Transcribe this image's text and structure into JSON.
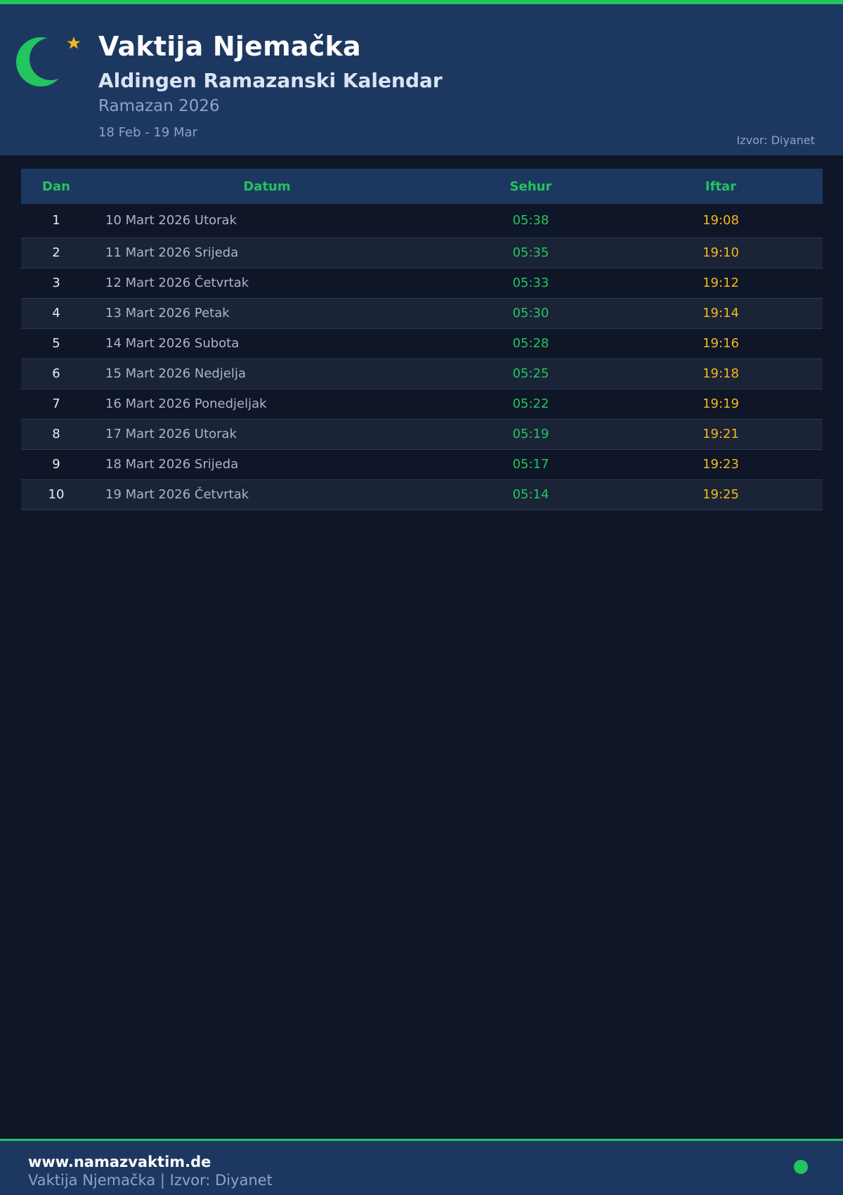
{
  "header": {
    "title": "Vaktija Njemačka",
    "subtitle": "Aldingen Ramazanski Kalendar",
    "period": "Ramazan 2026",
    "date_range": "18 Feb - 19 Mar",
    "source": "Izvor: Diyanet",
    "logo_icon": "crescent-star-icon"
  },
  "table": {
    "columns": [
      "Dan",
      "Datum",
      "Sehur",
      "Iftar"
    ],
    "rows": [
      {
        "dan": "1",
        "datum": "10 Mart 2026 Utorak",
        "sehur": "05:38",
        "iftar": "19:08"
      },
      {
        "dan": "2",
        "datum": "11 Mart 2026 Srijeda",
        "sehur": "05:35",
        "iftar": "19:10"
      },
      {
        "dan": "3",
        "datum": "12 Mart 2026 Četvrtak",
        "sehur": "05:33",
        "iftar": "19:12"
      },
      {
        "dan": "4",
        "datum": "13 Mart 2026 Petak",
        "sehur": "05:30",
        "iftar": "19:14"
      },
      {
        "dan": "5",
        "datum": "14 Mart 2026 Subota",
        "sehur": "05:28",
        "iftar": "19:16"
      },
      {
        "dan": "6",
        "datum": "15 Mart 2026 Nedjelja",
        "sehur": "05:25",
        "iftar": "19:18"
      },
      {
        "dan": "7",
        "datum": "16 Mart 2026 Ponedjeljak",
        "sehur": "05:22",
        "iftar": "19:19"
      },
      {
        "dan": "8",
        "datum": "17 Mart 2026 Utorak",
        "sehur": "05:19",
        "iftar": "19:21"
      },
      {
        "dan": "9",
        "datum": "18 Mart 2026 Srijeda",
        "sehur": "05:17",
        "iftar": "19:23"
      },
      {
        "dan": "10",
        "datum": "19 Mart 2026 Četvrtak",
        "sehur": "05:14",
        "iftar": "19:25"
      }
    ]
  },
  "footer": {
    "site": "www.namazvaktim.de",
    "subtitle": "Vaktija Njemačka | Izvor: Diyanet"
  },
  "colors": {
    "accent": "#22c55e",
    "iftar": "#f5b81d",
    "header_bg": "#1d3860",
    "page_bg": "#0e1628"
  }
}
